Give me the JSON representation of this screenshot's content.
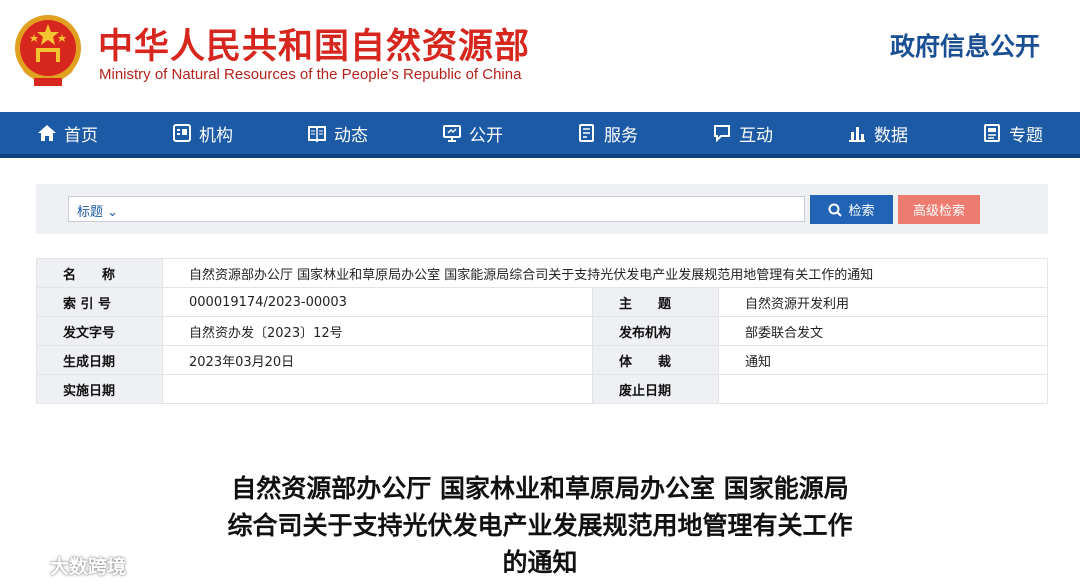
{
  "header": {
    "title_cn": "中华人民共和国自然资源部",
    "title_en": "Ministry of Natural Resources of the People’s Republic of China",
    "gov_info": "政府信息公开"
  },
  "nav": {
    "items": [
      {
        "label": "首页",
        "icon": "home-icon"
      },
      {
        "label": "机构",
        "icon": "org-icon"
      },
      {
        "label": "动态",
        "icon": "book-icon"
      },
      {
        "label": "公开",
        "icon": "monitor-icon"
      },
      {
        "label": "服务",
        "icon": "document-icon"
      },
      {
        "label": "互动",
        "icon": "chat-icon"
      },
      {
        "label": "数据",
        "icon": "bar-chart-icon"
      },
      {
        "label": "专题",
        "icon": "topic-icon"
      }
    ]
  },
  "search": {
    "select_label": "标题",
    "search_button": "检索",
    "advanced_button": "高级检索"
  },
  "meta": {
    "name_label": "名　　称",
    "name_value": "自然资源部办公厅 国家林业和草原局办公室 国家能源局综合司关于支持光伏发电产业发展规范用地管理有关工作的通知",
    "index_label": "索 引 号",
    "index_value": "000019174/2023-00003",
    "subject_label": "主　　题",
    "subject_value": "自然资源开发利用",
    "docno_label": "发文字号",
    "docno_value": "自然资办发〔2023〕12号",
    "issuer_label": "发布机构",
    "issuer_value": "部委联合发文",
    "date_label": "生成日期",
    "date_value": "2023年03月20日",
    "genre_label": "体　　裁",
    "genre_value": "通知",
    "effective_label": "实施日期",
    "effective_value": "",
    "expire_label": "废止日期",
    "expire_value": ""
  },
  "document": {
    "title_line1": "自然资源部办公厅 国家林业和草原局办公室 国家能源局",
    "title_line2": "综合司关于支持光伏发电产业发展规范用地管理有关工作",
    "title_line3": "的通知"
  },
  "watermark": {
    "text": "大数跨境"
  },
  "colors": {
    "nav_blue": "#1d5aa5",
    "title_red": "#d7261d",
    "gov_info_blue": "#1b4f93",
    "search_button": "#2163b4",
    "advanced_button": "#ee7b6f"
  }
}
